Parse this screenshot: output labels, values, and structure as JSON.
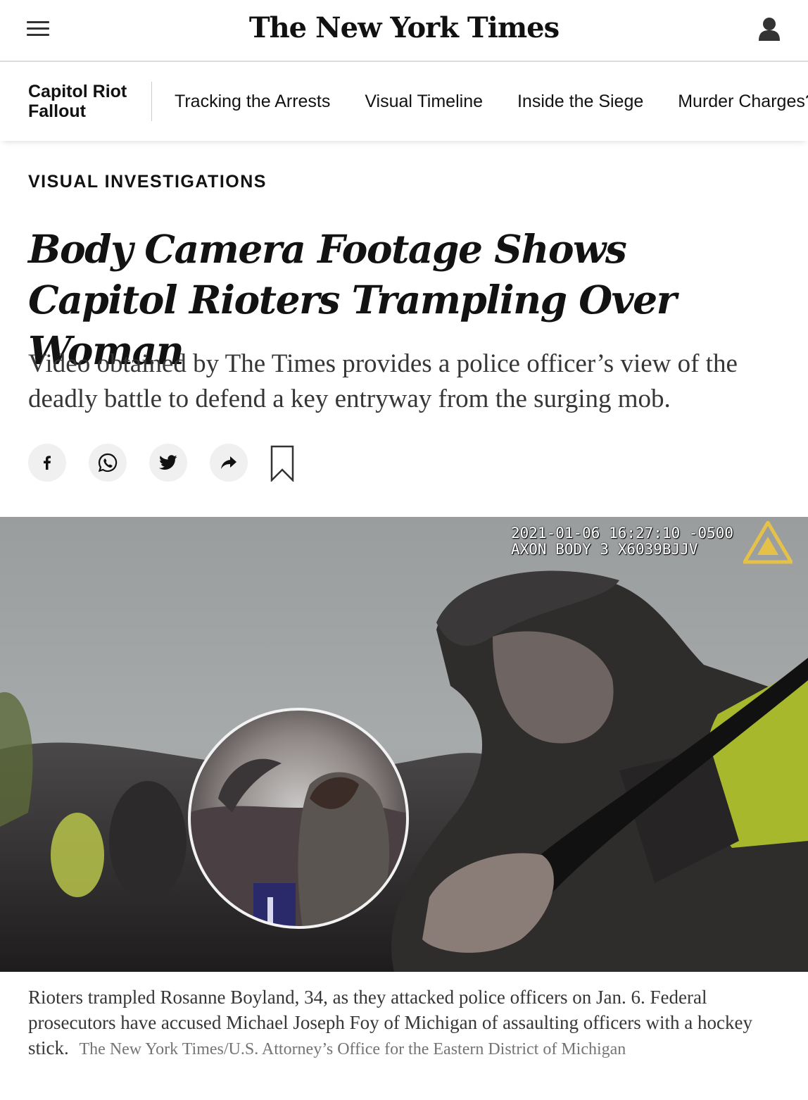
{
  "masthead": {
    "logo_text": "The New York Times",
    "menu_icon": "hamburger-menu-icon",
    "account_icon": "user-account-icon"
  },
  "section_nav": {
    "title": "Capitol Riot Fallout",
    "links": [
      {
        "label": "Tracking the Arrests"
      },
      {
        "label": "Visual Timeline"
      },
      {
        "label": "Inside the Siege"
      },
      {
        "label": "Murder Charges?"
      }
    ]
  },
  "article": {
    "kicker": "VISUAL INVESTIGATIONS",
    "headline": "Body Camera Footage Shows Capitol Rioters Trampling Over Woman",
    "summary": "Video obtained by The Times provides a police officer’s view of the deadly battle to defend a key entryway from the surging mob."
  },
  "share": {
    "buttons": [
      {
        "name": "facebook",
        "icon": "facebook-icon"
      },
      {
        "name": "whatsapp",
        "icon": "whatsapp-icon"
      },
      {
        "name": "twitter",
        "icon": "twitter-icon"
      },
      {
        "name": "share",
        "icon": "share-arrow-icon"
      }
    ],
    "bookmark_icon": "bookmark-icon"
  },
  "media": {
    "bodycam_timestamp": "2021-01-06 16:27:10 -0500",
    "bodycam_device": "AXON BODY 3 X6039BJJV",
    "caption": "Rioters trampled Rosanne Boyland, 34, as they attacked police officers on Jan. 6. Federal prosecutors have accused Michael Joseph Foy of Michigan of assaulting officers with a hockey stick.",
    "credit": "The New York Times/U.S. Attorney’s Office for the Eastern District of Michigan"
  },
  "colors": {
    "text": "#121212",
    "summary_text": "#363636",
    "credit_text": "#727272",
    "divider": "#dcdcdc",
    "share_bg": "#f0f0f0"
  }
}
